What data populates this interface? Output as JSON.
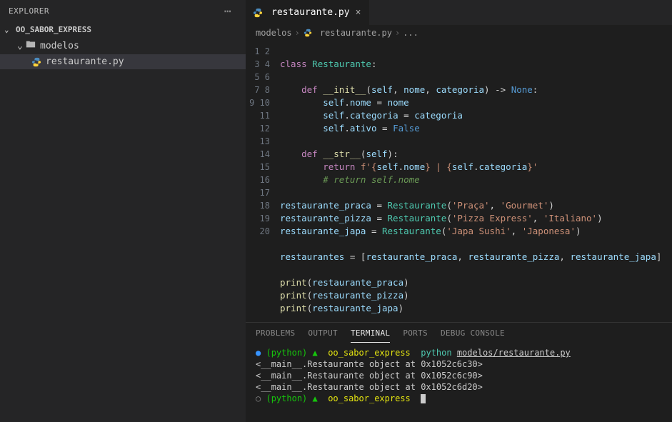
{
  "explorer": {
    "title": "EXPLORER",
    "project": "OO_SABOR_EXPRESS",
    "folder": "modelos",
    "file": "restaurante.py"
  },
  "tab": {
    "name": "restaurante.py"
  },
  "breadcrumb": {
    "folder": "modelos",
    "file": "restaurante.py",
    "trail": "..."
  },
  "code": {
    "lines": 20,
    "class_name": "Restaurante",
    "init": "__init__",
    "self": "self",
    "nome": "nome",
    "categoria": "categoria",
    "ativo": "ativo",
    "none": "None",
    "false": "False",
    "str": "__str__",
    "return": "return",
    "comment": "# return self.nome",
    "var_praca": "restaurante_praca",
    "var_pizza": "restaurante_pizza",
    "var_japa": "restaurante_japa",
    "var_list": "restaurantes",
    "praca_name": "'Praça'",
    "praca_cat": "'Gourmet'",
    "pizza_name": "'Pizza Express'",
    "pizza_cat": "'Italiano'",
    "japa_name": "'Japa Sushi'",
    "japa_cat": "'Japonesa'",
    "print": "print",
    "def": "def",
    "class": "class",
    "fstr_open": "f'{",
    "fstr_mid": "} | {",
    "fstr_close": "}'"
  },
  "panel": {
    "tabs": {
      "problems": "PROBLEMS",
      "output": "OUTPUT",
      "terminal": "TERMINAL",
      "ports": "PORTS",
      "debug": "DEBUG CONSOLE"
    },
    "terminal": {
      "env": "(python)",
      "dir": "oo_sabor_express",
      "cmd_python": "python",
      "cmd_path": "modelos/restaurante.py",
      "out1": "<__main__.Restaurante object at 0x1052c6c30>",
      "out2": "<__main__.Restaurante object at 0x1052c6c90>",
      "out3": "<__main__.Restaurante object at 0x1052c6d20>"
    }
  }
}
